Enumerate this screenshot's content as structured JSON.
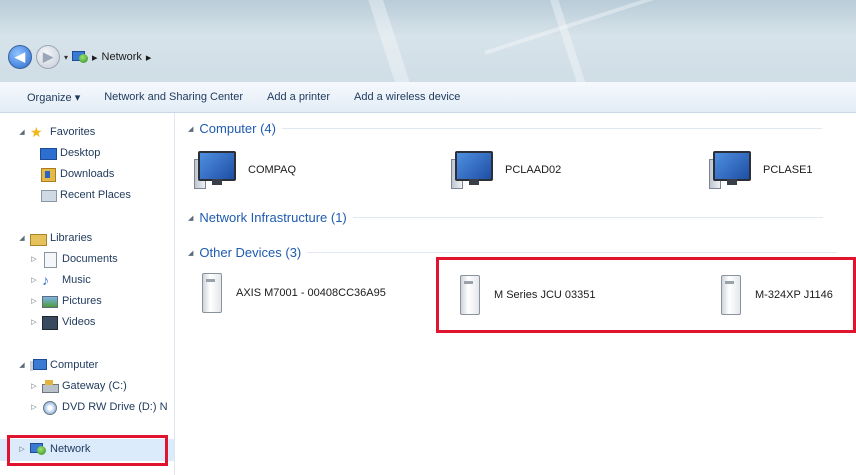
{
  "address": {
    "location": "Network",
    "separator": "▸"
  },
  "toolbar": {
    "organize": "Organize ▾",
    "network_sharing": "Network and Sharing Center",
    "add_printer": "Add a printer",
    "add_wireless": "Add a wireless device"
  },
  "nav": {
    "favorites": {
      "label": "Favorites",
      "items": [
        "Desktop",
        "Downloads",
        "Recent Places"
      ]
    },
    "libraries": {
      "label": "Libraries",
      "items": [
        "Documents",
        "Music",
        "Pictures",
        "Videos"
      ]
    },
    "computer": {
      "label": "Computer",
      "items": [
        "Gateway (C:)",
        "DVD RW Drive (D:) N"
      ]
    },
    "network": {
      "label": "Network"
    }
  },
  "groups": {
    "computer": {
      "label": "Computer (4)",
      "items": [
        "COMPAQ",
        "PCLAAD02",
        "PCLASE1"
      ]
    },
    "infrastructure": {
      "label": "Network Infrastructure (1)"
    },
    "other": {
      "label": "Other Devices (3)",
      "items": [
        "AXIS M7001 - 00408CC36A95",
        "M Series JCU 03351",
        "M-324XP J1146"
      ]
    }
  },
  "colors": {
    "highlight": "#e0142e",
    "group_header": "#1e5bb0",
    "selected_nav": "#dcebfc"
  }
}
